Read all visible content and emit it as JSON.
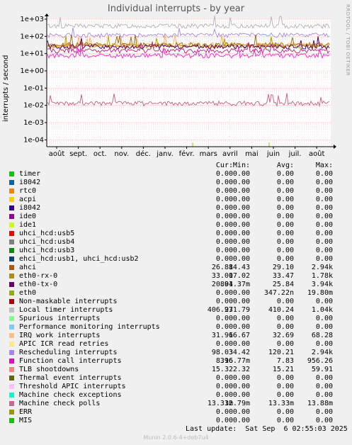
{
  "title": "Individual interrupts - by year",
  "side_text": "RRDTOOL / TOBI OETIKER",
  "colors": {
    "background": "#f0f0f0",
    "plot_bg": "#ffffff",
    "grid": "#ffaaaa",
    "axis": "#000000"
  },
  "chart_data": {
    "type": "line",
    "ylabel": "interrupts / second",
    "yscale": "log",
    "ylim": [
      4e-05,
      1000
    ],
    "yticks": [
      "1e+03",
      "1e+02",
      "1e+01",
      "1e+00",
      "1e-01",
      "1e-02",
      "1e-03",
      "1e-04"
    ],
    "xticks": [
      "août",
      "sept.",
      "oct.",
      "nov.",
      "déc.",
      "janv.",
      "févr.",
      "mars",
      "avril",
      "mai",
      "juin",
      "juil.",
      "août"
    ],
    "series": [
      {
        "name": "Local timer interrupts",
        "color": "#b8b8b8",
        "avg": 410.24
      },
      {
        "name": "Rescheduling interrupts",
        "color": "#b090e0",
        "avg": 120.21
      },
      {
        "name": "IRQ work interrupts",
        "color": "#ffb060",
        "avg": 32.69
      },
      {
        "name": "eth0-rx-0",
        "color": "#a07020",
        "avg": 33.47
      },
      {
        "name": "ahci",
        "color": "#c0a000",
        "avg": 29.1
      },
      {
        "name": "eth0-tx-0",
        "color": "#5c0060",
        "avg": 25.84
      },
      {
        "name": "TLB shootdowns",
        "color": "#c03080",
        "avg": 15.21
      },
      {
        "name": "Function call interrupts",
        "color": "#ff30d0",
        "avg": 7.83
      },
      {
        "name": "Machine check polls",
        "color": "#cc6688",
        "avg": 0.01333
      }
    ]
  },
  "legend": {
    "headers": {
      "cur": "Cur:",
      "min": "Min:",
      "avg": "Avg:",
      "max": "Max:"
    },
    "rows": [
      {
        "name": "timer",
        "color": "#00cc00",
        "cur": "0.00",
        "min": "0.00",
        "avg": "0.00",
        "max": "0.00"
      },
      {
        "name": "i8042",
        "color": "#0066b3",
        "cur": "0.00",
        "min": "0.00",
        "avg": "0.00",
        "max": "0.00"
      },
      {
        "name": "rtc0",
        "color": "#ff8000",
        "cur": "0.00",
        "min": "0.00",
        "avg": "0.00",
        "max": "0.00"
      },
      {
        "name": "acpi",
        "color": "#ffcc00",
        "cur": "0.00",
        "min": "0.00",
        "avg": "0.00",
        "max": "0.00"
      },
      {
        "name": "i8042",
        "color": "#330099",
        "cur": "0.00",
        "min": "0.00",
        "avg": "0.00",
        "max": "0.00"
      },
      {
        "name": "ide0",
        "color": "#990099",
        "cur": "0.00",
        "min": "0.00",
        "avg": "0.00",
        "max": "0.00"
      },
      {
        "name": "ide1",
        "color": "#ccff00",
        "cur": "0.00",
        "min": "0.00",
        "avg": "0.00",
        "max": "0.00"
      },
      {
        "name": "uhci_hcd:usb5",
        "color": "#ff0000",
        "cur": "0.00",
        "min": "0.00",
        "avg": "0.00",
        "max": "0.00"
      },
      {
        "name": "uhci_hcd:usb4",
        "color": "#808080",
        "cur": "0.00",
        "min": "0.00",
        "avg": "0.00",
        "max": "0.00"
      },
      {
        "name": "uhci_hcd:usb3",
        "color": "#008f00",
        "cur": "0.00",
        "min": "0.00",
        "avg": "0.00",
        "max": "0.00"
      },
      {
        "name": "ehci_hcd:usb1, uhci_hcd:usb2",
        "color": "#00487d",
        "cur": "0.00",
        "min": "0.00",
        "avg": "0.00",
        "max": "0.00"
      },
      {
        "name": "ahci",
        "color": "#b35a00",
        "cur": "26.88",
        "min": "14.43",
        "avg": "29.10",
        "max": "2.94k"
      },
      {
        "name": "eth0-rx-0",
        "color": "#b38f00",
        "cur": "33.00",
        "min": "17.02",
        "avg": "33.47",
        "max": "1.78k"
      },
      {
        "name": "eth0-tx-0",
        "color": "#6b006b",
        "cur": "20.04",
        "min": "891.37m",
        "avg": "25.84",
        "max": "3.94k"
      },
      {
        "name": "eth0",
        "color": "#8fb300",
        "cur": "0.00",
        "min": "0.00",
        "avg": "347.22n",
        "max": "19.80m"
      },
      {
        "name": "Non-maskable interrupts",
        "color": "#b30000",
        "cur": "0.00",
        "min": "0.00",
        "avg": "0.00",
        "max": "0.00"
      },
      {
        "name": "Local timer interrupts",
        "color": "#bebebe",
        "cur": "406.97",
        "min": "231.79",
        "avg": "410.24",
        "max": "1.04k"
      },
      {
        "name": "Spurious interrupts",
        "color": "#80ff80",
        "cur": "0.00",
        "min": "0.00",
        "avg": "0.00",
        "max": "0.00"
      },
      {
        "name": "Performance monitoring interrupts",
        "color": "#80c9ff",
        "cur": "0.00",
        "min": "0.00",
        "avg": "0.00",
        "max": "0.00"
      },
      {
        "name": "IRQ work interrupts",
        "color": "#ffc080",
        "cur": "31.96",
        "min": "16.67",
        "avg": "32.69",
        "max": "68.28"
      },
      {
        "name": "APIC ICR read retries",
        "color": "#ffe680",
        "cur": "0.00",
        "min": "0.00",
        "avg": "0.00",
        "max": "0.00"
      },
      {
        "name": "Rescheduling interrupts",
        "color": "#aa80ff",
        "cur": "98.03",
        "min": "34.42",
        "avg": "120.21",
        "max": "2.94k"
      },
      {
        "name": "Function call interrupts",
        "color": "#ee00cc",
        "cur": "8.16",
        "min": "396.77m",
        "avg": "7.83",
        "max": "956.26"
      },
      {
        "name": "TLB shootdowns",
        "color": "#ff8080",
        "cur": "15.32",
        "min": "2.32",
        "avg": "15.21",
        "max": "59.91"
      },
      {
        "name": "Thermal event interrupts",
        "color": "#666600",
        "cur": "0.00",
        "min": "0.00",
        "avg": "0.00",
        "max": "0.00"
      },
      {
        "name": "Threshold APIC interrupts",
        "color": "#ffbfff",
        "cur": "0.00",
        "min": "0.00",
        "avg": "0.00",
        "max": "0.00"
      },
      {
        "name": "Machine check exceptions",
        "color": "#00ffcc",
        "cur": "0.00",
        "min": "0.00",
        "avg": "0.00",
        "max": "0.00"
      },
      {
        "name": "Machine check polls",
        "color": "#cc6699",
        "cur": "13.33m",
        "min": "12.79m",
        "avg": "13.33m",
        "max": "13.88m"
      },
      {
        "name": "ERR",
        "color": "#999900",
        "cur": "0.00",
        "min": "0.00",
        "avg": "0.00",
        "max": "0.00"
      },
      {
        "name": "MIS",
        "color": "#00cc00",
        "cur": "0.00",
        "min": "0.00",
        "avg": "0.00",
        "max": "0.00"
      }
    ]
  },
  "footer": {
    "last_update": "Last update:  Sat Sep  6 02:55:03 2025",
    "munin": "Munin 2.0.6-4+deb7u4"
  }
}
